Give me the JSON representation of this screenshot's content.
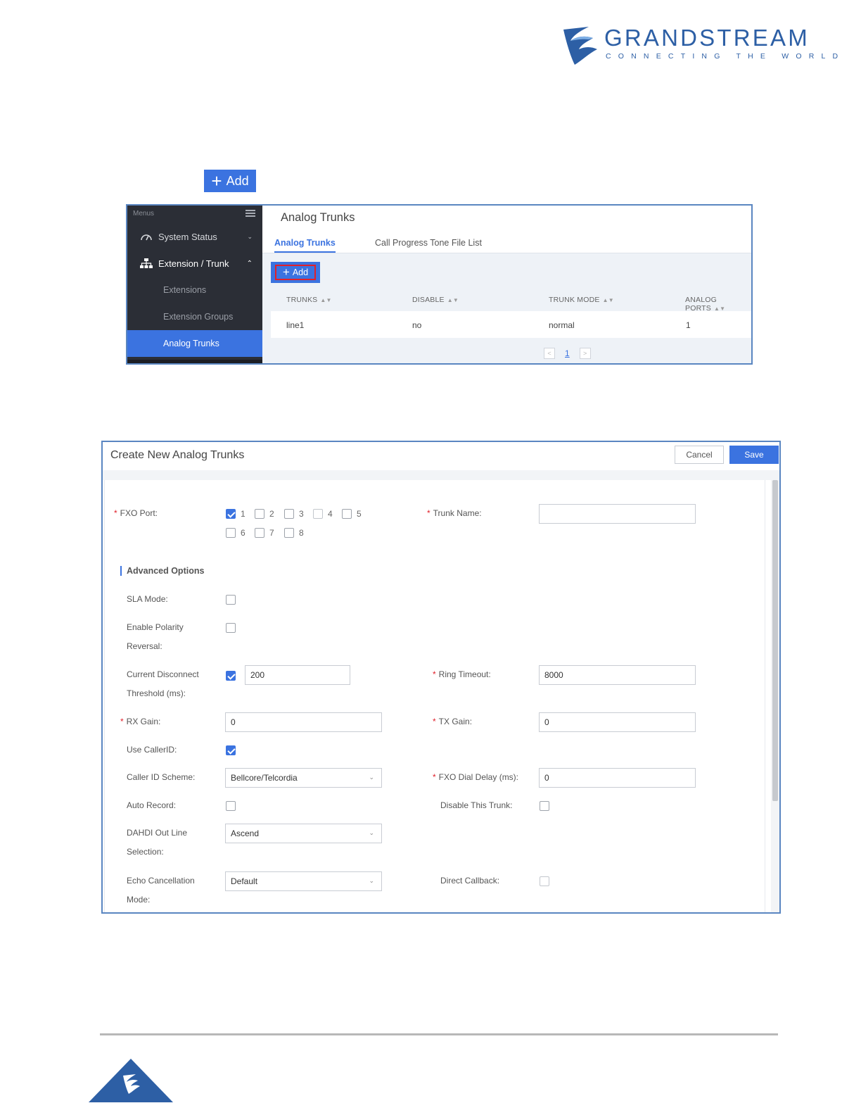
{
  "brand": {
    "name": "GRANDSTREAM",
    "tagline": "CONNECTING THE WORLD",
    "colors": {
      "brand_blue": "#2d5fa5",
      "accent": "#3b73e0",
      "highlight_red": "#e0202a",
      "sidebar": "#2b2e36"
    }
  },
  "standalone_button": {
    "label": "Add",
    "icon": "plus-icon"
  },
  "screenshot1": {
    "sidebar": {
      "header": "Menus",
      "items": [
        {
          "label": "System Status",
          "icon": "gauge-icon",
          "chevron": "chevron-down-icon"
        },
        {
          "label": "Extension / Trunk",
          "icon": "network-icon",
          "chevron": "chevron-up-icon"
        }
      ],
      "subitems": [
        {
          "label": "Extensions"
        },
        {
          "label": "Extension Groups"
        },
        {
          "label": "Analog Trunks",
          "active": true
        }
      ]
    },
    "page_title": "Analog Trunks",
    "tabs": [
      {
        "label": "Analog Trunks",
        "active": true
      },
      {
        "label": "Call Progress Tone File List",
        "active": false
      }
    ],
    "add_button": "Add",
    "table": {
      "columns": [
        "TRUNKS",
        "DISABLE",
        "TRUNK MODE",
        "ANALOG PORTS"
      ],
      "rows": [
        [
          "line1",
          "no",
          "normal",
          "1"
        ]
      ]
    },
    "pagination": {
      "current_page": "1"
    }
  },
  "screenshot2": {
    "title": "Create New Analog Trunks",
    "buttons": {
      "cancel": "Cancel",
      "save": "Save"
    },
    "fxo_port": {
      "label": "FXO Port:",
      "ports": [
        {
          "num": "1",
          "checked": true
        },
        {
          "num": "2",
          "checked": false
        },
        {
          "num": "3",
          "checked": false
        },
        {
          "num": "4",
          "checked": false,
          "disabled": true
        },
        {
          "num": "5",
          "checked": false
        },
        {
          "num": "6",
          "checked": false
        },
        {
          "num": "7",
          "checked": false
        },
        {
          "num": "8",
          "checked": false
        }
      ]
    },
    "trunk_name": {
      "label": "Trunk Name:",
      "value": ""
    },
    "advanced_title": "Advanced Options",
    "sla_mode": {
      "label": "SLA Mode:",
      "checked": false
    },
    "polarity": {
      "label_line1": "Enable Polarity",
      "label_line2": "Reversal:",
      "checked": false
    },
    "disconnect": {
      "label_line1": "Current Disconnect",
      "label_line2": "Threshold (ms):",
      "checked": true,
      "value": "200"
    },
    "ring_timeout": {
      "label": "Ring Timeout:",
      "value": "8000"
    },
    "rx_gain": {
      "label": "RX Gain:",
      "value": "0"
    },
    "tx_gain": {
      "label": "TX Gain:",
      "value": "0"
    },
    "use_callerid": {
      "label": "Use CallerID:",
      "checked": true
    },
    "callerid_scheme": {
      "label": "Caller ID Scheme:",
      "value": "Bellcore/Telcordia"
    },
    "dial_delay": {
      "label": "FXO Dial Delay (ms):",
      "value": "0"
    },
    "auto_record": {
      "label": "Auto Record:",
      "checked": false
    },
    "disable_trunk": {
      "label": "Disable This Trunk:",
      "checked": false
    },
    "dahdi": {
      "label_line1": "DAHDI Out Line",
      "label_line2": "Selection:",
      "value": "Ascend"
    },
    "echo": {
      "label_line1": "Echo Cancellation",
      "label_line2": "Mode:",
      "value": "Default"
    },
    "direct_callback": {
      "label": "Direct Callback:",
      "checked": false
    }
  }
}
